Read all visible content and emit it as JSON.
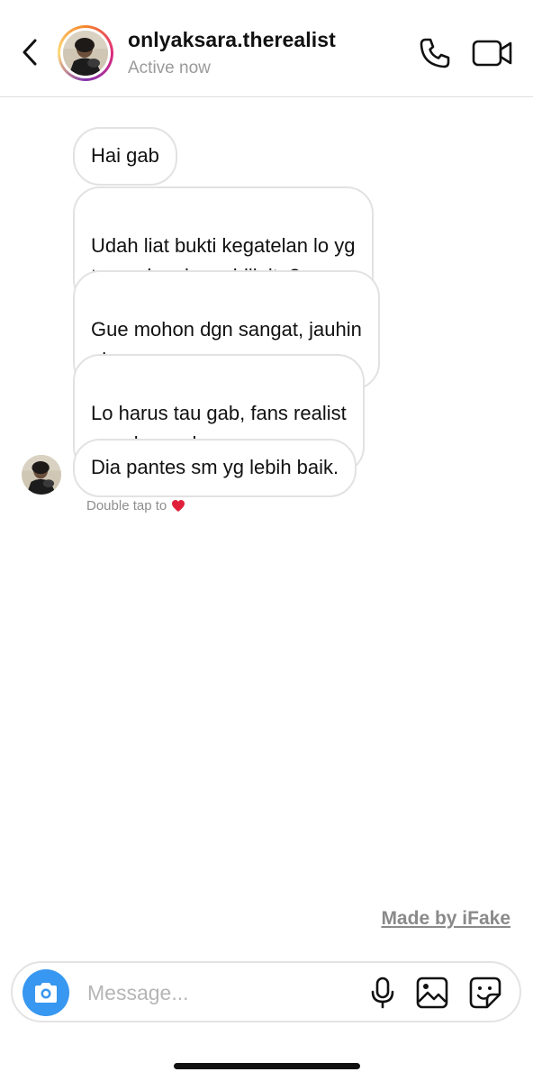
{
  "header": {
    "username": "onlyaksara.therealist",
    "status": "Active now"
  },
  "messages": [
    {
      "text": "Hai gab"
    },
    {
      "text": "Udah liat bukti kegatelan lo yg\nterungkap ke publik itu?"
    },
    {
      "text": "Gue mohon dgn sangat, jauhin\naksara."
    },
    {
      "text": "Lo harus tau gab, fans realist\ngasuka sm lo."
    },
    {
      "text": "Dia pantes sm yg lebih baik."
    }
  ],
  "hint": {
    "text": "Double tap to",
    "icon": "heart-icon",
    "icon_color": "#e0203a"
  },
  "watermark": {
    "text": "Made by iFake"
  },
  "composer": {
    "placeholder": "Message...",
    "value": ""
  },
  "colors": {
    "accent": "#3897f0",
    "bubble_border": "#e2e2e2",
    "muted": "#9a9a9a"
  },
  "icons": [
    "back-chevron-icon",
    "phone-icon",
    "video-camera-icon",
    "camera-icon",
    "microphone-icon",
    "gallery-icon",
    "sticker-icon",
    "heart-icon"
  ]
}
